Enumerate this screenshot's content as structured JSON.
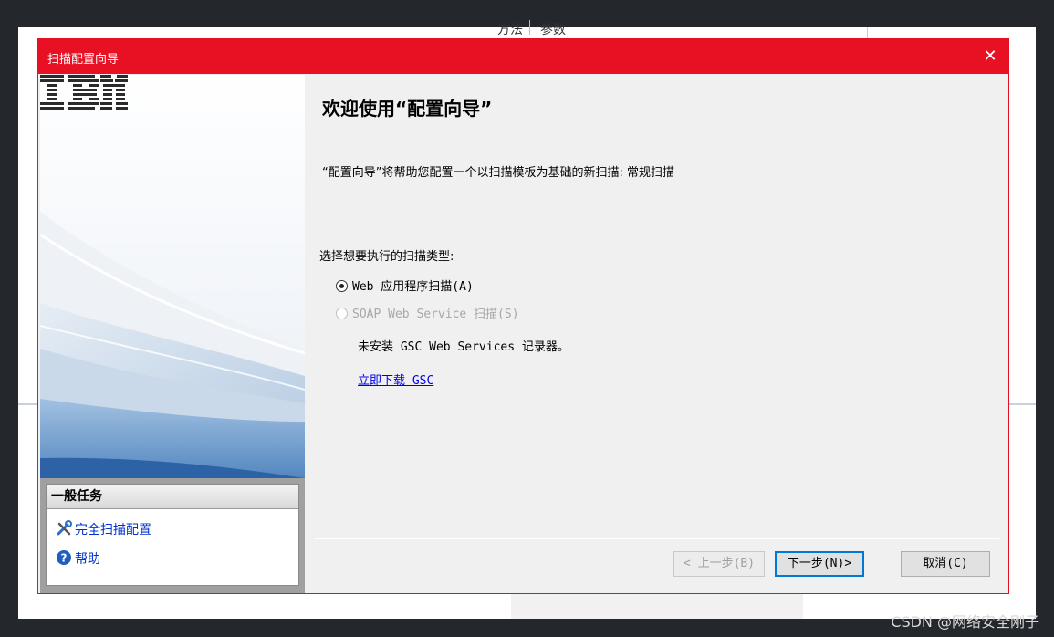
{
  "background": {
    "header_col1": "方法",
    "header_col2": "参数"
  },
  "dialog": {
    "title": "扫描配置向导",
    "close_glyph": "✕"
  },
  "left_panel": {
    "logo_text": "IBM",
    "tasks_title": "一般任务",
    "task_full_scan": "完全扫描配置",
    "task_help": "帮助"
  },
  "content": {
    "heading": "欢迎使用“配置向导”",
    "description": "“配置向导”将帮助您配置一个以扫描模板为基础的新扫描: 常规扫描",
    "scan_type_prompt": "选择想要执行的扫描类型:",
    "options": [
      {
        "label": "Web 应用程序扫描(A)",
        "selected": true,
        "enabled": true
      },
      {
        "label": "SOAP Web Service 扫描(S)",
        "selected": false,
        "enabled": false
      }
    ],
    "gsc_note": "未安装 GSC Web Services 记录器。",
    "download_link": "立即下载 GSC"
  },
  "buttons": {
    "back": "< 上一步(B)",
    "next": "下一步(N)>",
    "cancel": "取消(C)"
  },
  "watermark": "CSDN @网络安全刚子",
  "colors": {
    "titlebar": "#e81123",
    "link": "#0000ee",
    "default_button_border": "#0078d7"
  }
}
